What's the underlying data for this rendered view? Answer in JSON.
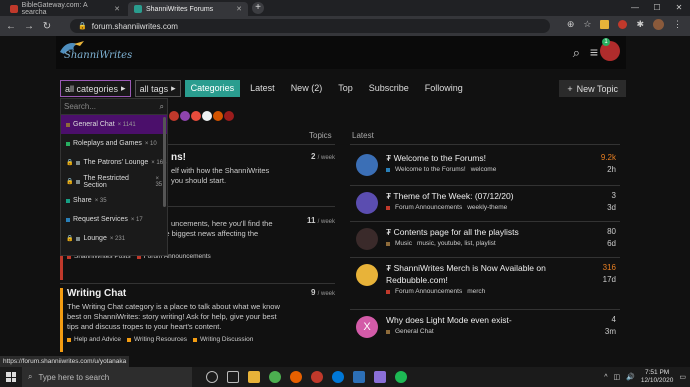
{
  "browser": {
    "tabs": [
      {
        "title": "BibleGateway.com: A searcha",
        "favicon_color": "#c0392b"
      },
      {
        "title": "ShanniWrites Forums",
        "favicon_color": "#2a9d8f"
      }
    ],
    "url": "forum.shanniiwrites.com"
  },
  "site": {
    "logo_text": "ShanniWrites",
    "notification_count": "1"
  },
  "nav": {
    "categories_dd": "all categories",
    "tags_dd": "all tags",
    "links": [
      "Categories",
      "Latest",
      "New (2)",
      "Top",
      "Subscribe",
      "Following"
    ],
    "new_topic": "New Topic"
  },
  "dropdown": {
    "search_placeholder": "Search...",
    "items": [
      {
        "name": "General Chat",
        "count": "× 1141",
        "color": "#8e6b3a",
        "locked": false
      },
      {
        "name": "Roleplays and Games",
        "count": "× 10",
        "color": "#27ae60",
        "locked": false
      },
      {
        "name": "The Patrons' Lounge",
        "count": "× 163",
        "color": "#7f8c8d",
        "locked": true
      },
      {
        "name": "The Restricted Section",
        "count": "× 35",
        "color": "#7f8c8d",
        "locked": true
      },
      {
        "name": "Share",
        "count": "× 35",
        "color": "#16a085",
        "locked": false
      },
      {
        "name": "Request Services",
        "count": "× 17",
        "color": "#2980b9",
        "locked": false
      },
      {
        "name": "Lounge",
        "count": "× 231",
        "color": "#7f8c8d",
        "locked": true
      }
    ]
  },
  "columns": {
    "topics": "Topics",
    "latest": "Latest"
  },
  "categories": [
    {
      "title": "ns!",
      "desc": [
        "elf with how the ShanniWrites",
        "you should start."
      ],
      "per_week": "2",
      "unit": "/ week",
      "border": "#2980b9",
      "subcats": []
    },
    {
      "title": "",
      "desc": [
        "uncements, here you'll find the",
        "most recent blog posts and the biggest news affecting the",
        "website."
      ],
      "per_week": "11",
      "unit": "/ week",
      "border": "#c0392b",
      "subcats": [
        {
          "name": "ShanniWrites Posts",
          "color": "#c0392b"
        },
        {
          "name": "Forum Announcements",
          "color": "#c0392b"
        }
      ]
    },
    {
      "title": "Writing Chat",
      "desc": [
        "The Writing Chat category is a place to talk about what we know",
        "best on ShanniWrites: story writing! Ask for help, give your best",
        "tips and discuss tropes to your heart's content."
      ],
      "per_week": "9",
      "unit": "/ week",
      "border": "#f39c12",
      "subcats": [
        {
          "name": "Help and Advice",
          "color": "#f39c12"
        },
        {
          "name": "Writing Resources",
          "color": "#f39c12"
        },
        {
          "name": "Writing Discussion",
          "color": "#f39c12"
        }
      ]
    }
  ],
  "latest_topics": [
    {
      "title": "Welcome to the Forums!",
      "pinned": true,
      "category": "Welcome to the Forums!",
      "cat_color": "#2980b9",
      "tags": "welcome",
      "count": "9.2k",
      "time": "2h",
      "hot": true,
      "avatar_color": "#3b6fb6"
    },
    {
      "title": "Theme of The Week: (07/12/20)",
      "pinned": true,
      "category": "Forum Announcements",
      "cat_color": "#c0392b",
      "tags": "weekly-theme",
      "count": "3",
      "time": "3d",
      "hot": false,
      "avatar_color": "#5b4db0"
    },
    {
      "title": "Contents page for all the playlists",
      "pinned": true,
      "category": "Music",
      "cat_color": "#8e6b3a",
      "tags": "music, youtube, list, playlist",
      "count": "80",
      "time": "6d",
      "hot": false,
      "avatar_color": "#3a2a2a"
    },
    {
      "title": "ShanniWrites Merch is Now Available on Redbubble.com!",
      "pinned": true,
      "category": "Forum Announcements",
      "cat_color": "#c0392b",
      "tags": "merch",
      "count": "316",
      "time": "17d",
      "hot": true,
      "avatar_color": "#e8b339"
    },
    {
      "title": "Why does Light Mode even exist-",
      "pinned": false,
      "category": "General Chat",
      "cat_color": "#8e6b3a",
      "tags": "",
      "count": "4",
      "time": "3m",
      "hot": false,
      "avatar_color": "#d35ba8",
      "avatar_letter": "X"
    }
  ],
  "status_bar": "https://forum.shanniiwrites.com/u/yotanaka",
  "taskbar": {
    "search_placeholder": "Type here to search",
    "time": "7:51 PM",
    "date": "12/10/2020"
  }
}
